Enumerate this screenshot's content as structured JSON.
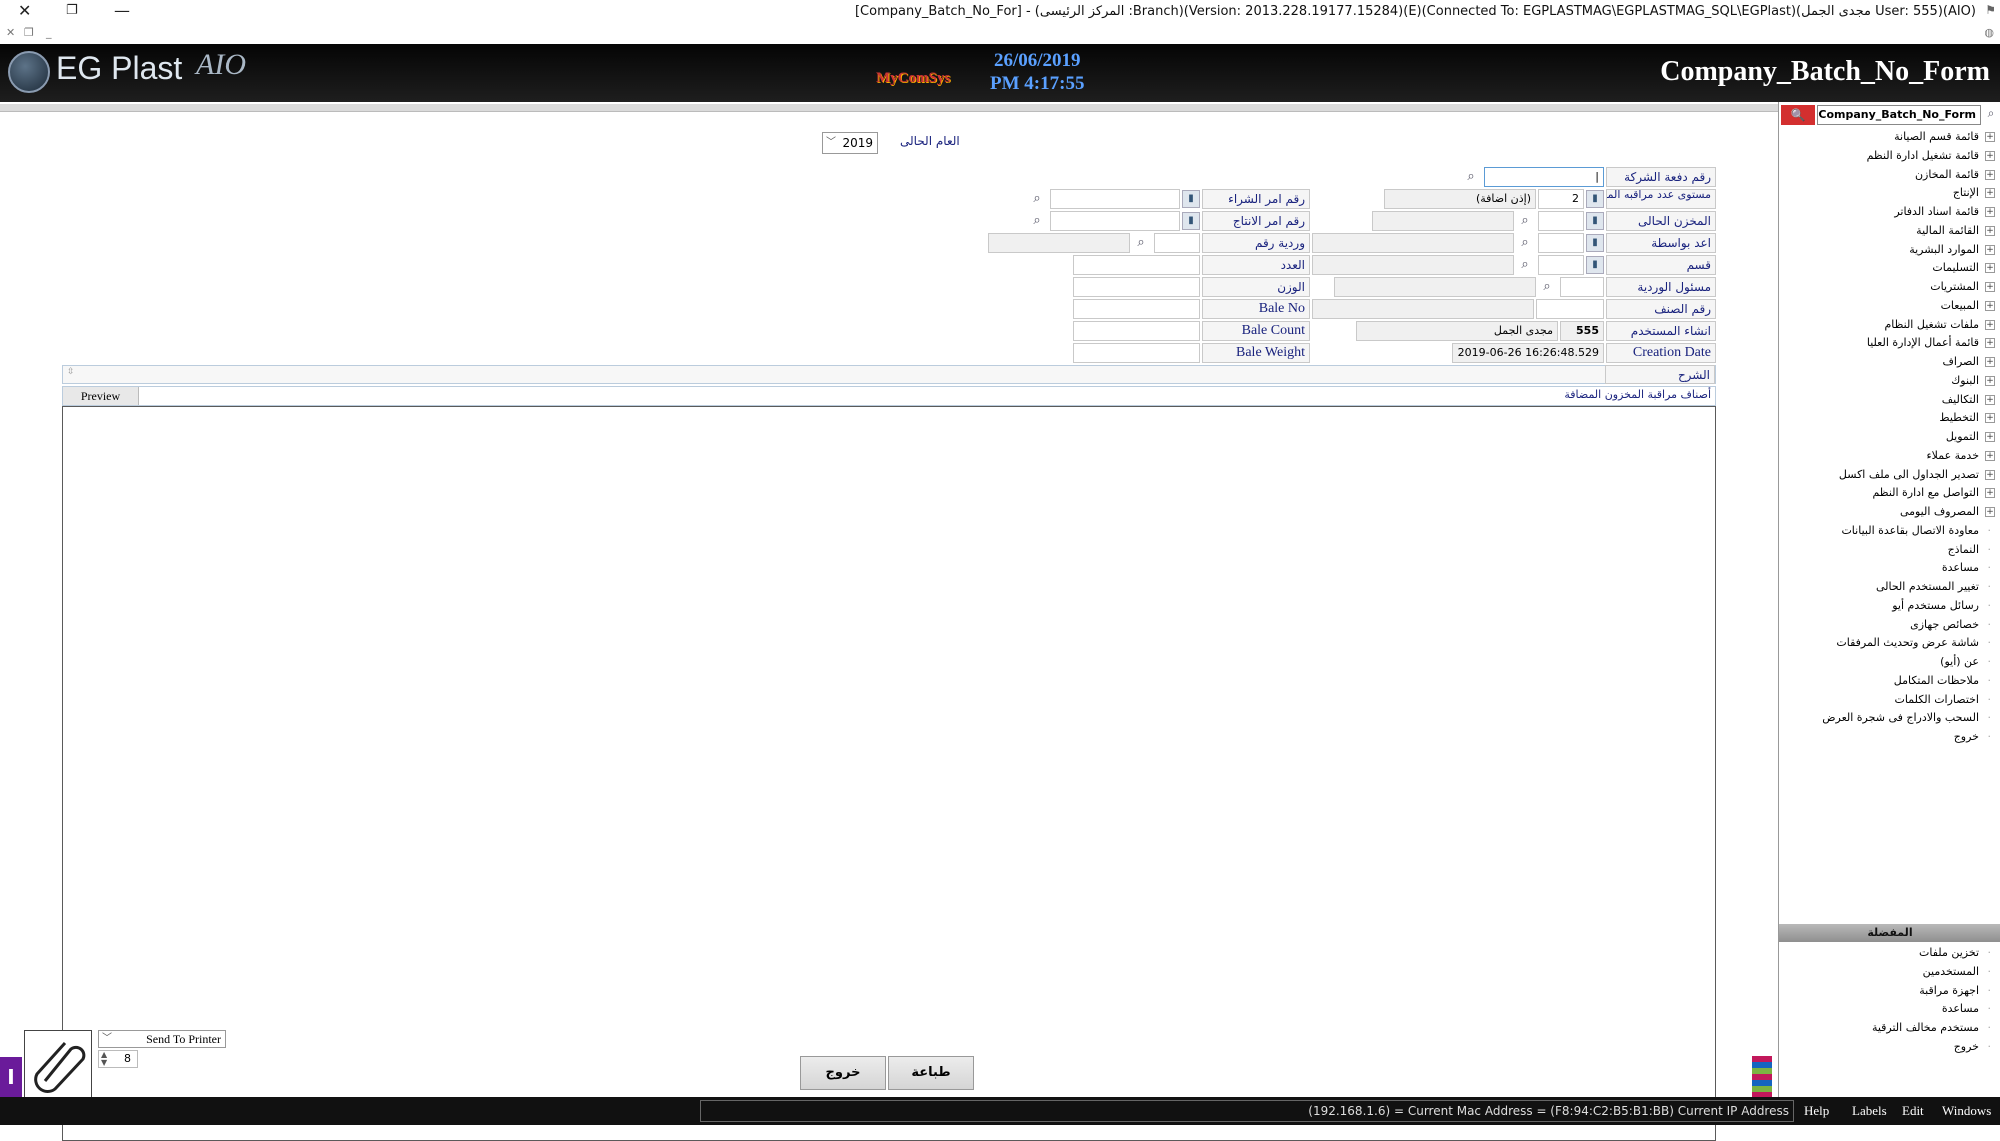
{
  "window": {
    "title": "[Company_Batch_No_For] - (المركز الرئيسى :Branch)(Version: 2013.228.19177.15284)(E)(Connected To: EGPLASTMAG\\EGPLASTMAG_SQL\\EGPlast)(مجدى الجمل User: 555)(AIO)"
  },
  "banner": {
    "logo": "EG Plast",
    "logo_suffix": "AIO",
    "brand": "MyComSys",
    "date": "26/06/2019",
    "time": "PM 4:17:55",
    "form_title": "Company_Batch_No_Form"
  },
  "year": {
    "label": "العام الحالى",
    "value": "2019"
  },
  "fields": {
    "batch_no": "رقم دفعة الشركة",
    "store_out": "مستوى عدد مراقبه المخزون",
    "store_out_value": "2",
    "store_out_desc": "(إذن اضافة)",
    "current_store": "المخزن الحالى",
    "prepared_by": "اعد بواسطة",
    "section": "قسم",
    "shift_manager": "مسئول الوردية",
    "item_no": "رقم الصنف",
    "created_user": "انشاء المستخدم",
    "created_user_id": "555",
    "created_user_name": "مجدى الجمل",
    "creation_date": "Creation Date",
    "creation_date_value": "2019-06-26 16:26:48.529",
    "notes": "الشرح",
    "po_no": "رقم امر الشراء",
    "prod_no": "رقم امر الانتاج",
    "shift_no": "وردية رقم",
    "count": "العدد",
    "weight": "الوزن",
    "bale_no": "Bale No",
    "bale_count": "Bale Count",
    "bale_weight": "Bale Weight"
  },
  "grid": {
    "preview": "Preview",
    "caption": "أصناف مراقبة المخزون المضافة"
  },
  "buttons": {
    "print": "طباعة",
    "exit": "خروج"
  },
  "printer": {
    "option": "Send To Printer",
    "copies": "8"
  },
  "side": {
    "search": "Company_Batch_No_Form",
    "tree": [
      {
        "label": "قائمة قسم الصيانة",
        "exp": true
      },
      {
        "label": "قائمة تشغيل ادارة النظم",
        "exp": true
      },
      {
        "label": "قائمة المخازن",
        "exp": true
      },
      {
        "label": "الإنتاج",
        "exp": true
      },
      {
        "label": "قائمة اسناد الدفاتر",
        "exp": true
      },
      {
        "label": "القائمة المالية",
        "exp": true
      },
      {
        "label": "الموارد البشرية",
        "exp": true
      },
      {
        "label": "التسليمات",
        "exp": true
      },
      {
        "label": "المشتريات",
        "exp": true
      },
      {
        "label": "المبيعات",
        "exp": true
      },
      {
        "label": "ملفات تشغيل النظام",
        "exp": true
      },
      {
        "label": "قائمة أعمال الإدارة العليا",
        "exp": true
      },
      {
        "label": "الصراف",
        "exp": true
      },
      {
        "label": "البنوك",
        "exp": true
      },
      {
        "label": "التكاليف",
        "exp": true
      },
      {
        "label": "التخطيط",
        "exp": true
      },
      {
        "label": "التمويل",
        "exp": true
      },
      {
        "label": "خدمة عملاء",
        "exp": true
      },
      {
        "label": "تصدير الجداول الى ملف اكسل",
        "exp": true
      },
      {
        "label": "التواصل مع ادارة النظم",
        "exp": true
      },
      {
        "label": "المصروف اليومى",
        "exp": true
      },
      {
        "label": "معاودة الاتصال بقاعدة البيانات",
        "exp": false
      },
      {
        "label": "النماذج",
        "exp": false
      },
      {
        "label": "مساعدة",
        "exp": false
      },
      {
        "label": "تغيير المستخدم الحالى",
        "exp": false
      },
      {
        "label": "رسائل مستخدم أيو",
        "exp": false
      },
      {
        "label": "خصائص جهازى",
        "exp": false
      },
      {
        "label": "شاشة عرض وتحديث المرفقات",
        "exp": false
      },
      {
        "label": "عن (أيو)",
        "exp": false
      },
      {
        "label": "ملاحظات المتكامل",
        "exp": false
      },
      {
        "label": "اختصارات الكلمات",
        "exp": false
      },
      {
        "label": "السحب والادراج فى شجرة العرض",
        "exp": false
      },
      {
        "label": "خروج",
        "exp": false
      }
    ],
    "favorites_header": "المفضلة",
    "favorites": [
      "تخزين ملفات",
      "المستخدمين",
      "اجهزة مراقبة",
      "مساعدة",
      "مستخدم مخالف الترقية",
      "خروج"
    ]
  },
  "status": {
    "text": "(192.168.1.6) = Current Mac Address = (F8:94:C2:B5:B1:BB) Current IP Address",
    "menus": [
      "Help",
      "Labels",
      "Edit",
      "Windows"
    ]
  },
  "colors": {
    "accent": "#1a237e",
    "banner": "#0a0a0a",
    "search_button": "#d32f2f"
  }
}
